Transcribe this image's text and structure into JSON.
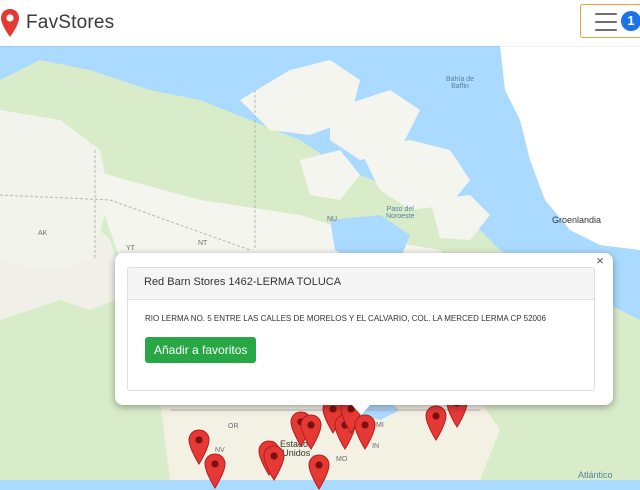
{
  "app": {
    "name": "FavStores",
    "brand_color": "#e53935"
  },
  "header": {
    "menu_icon": "hamburger-icon",
    "menu_badge": "1",
    "menu_border_color": "#e8a33a"
  },
  "map": {
    "labels": {
      "baffin": "Bahía de\nBaffin",
      "nu": "NU",
      "paso": "Paso del\nNoroeste",
      "groenlandia": "Groenlandia",
      "ak": "AK",
      "nt": "NT",
      "yt": "YT",
      "or": "OR",
      "nv": "NV",
      "mo": "MO",
      "in": "IN",
      "mi": "MI",
      "estados": "Estados\nUnidos",
      "atlantico": "Atlántico"
    }
  },
  "infowindow": {
    "title": "Red Barn Stores 1462-LERMA TOLUCA",
    "address": "RIO LERMA NO. 5 ENTRE LAS CALLES DE MORELOS Y EL CALVARIO, COL. LA MERCED LERMA CP 52006",
    "button_label": "Añadir a favoritos",
    "close_symbol": "×",
    "button_color": "#28a745"
  }
}
